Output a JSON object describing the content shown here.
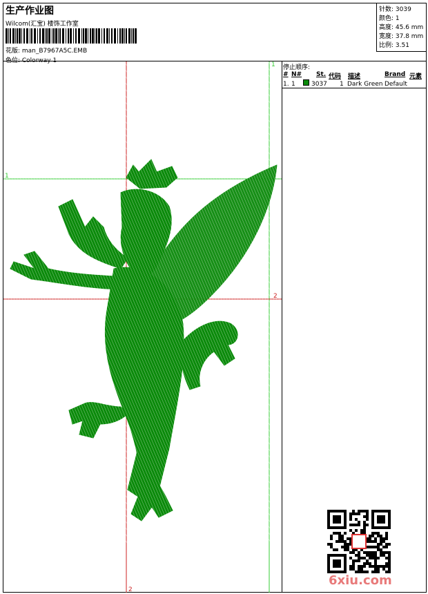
{
  "header": {
    "title": "生产作业图",
    "company": "Wilcom(汇宝) 楼饰工作室",
    "design_label": "花版: man_B7967A5C.EMB",
    "colorway_label": "色位: Colorway 1"
  },
  "stats": {
    "stitches": "针数: 3039",
    "colors": "颜色: 1",
    "height": "高度: 45.6 mm",
    "width": "宽度: 37.8 mm",
    "scale": "比例: 3.51"
  },
  "panel": {
    "stop_sequence": "停止顺序:",
    "columns": [
      "#",
      "N#",
      "St.",
      "代码",
      "描述",
      "Brand",
      "元素"
    ],
    "rows": [
      {
        "index": "1.",
        "needle": "1",
        "stitches": "3037",
        "code": "1",
        "description": "Dark Green",
        "brand": "Default",
        "color": "#0a8a0a"
      }
    ]
  },
  "guides": {
    "green_h": "1",
    "green_v": "1",
    "red_h": "2",
    "red_v": "2"
  },
  "colors": {
    "embroidery": "#0a8a0a",
    "guide_green": "#33cc33",
    "guide_red": "#cc2222"
  },
  "watermark": "6xiu.com"
}
